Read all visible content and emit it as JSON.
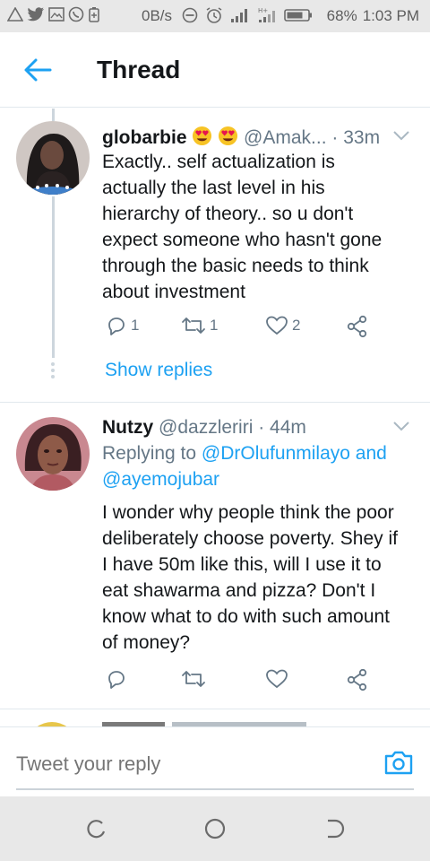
{
  "status_bar": {
    "speed": "0B/s",
    "battery": "68%",
    "time": "1:03 PM"
  },
  "header": {
    "title": "Thread",
    "back_icon": "arrow-left-icon"
  },
  "tweets": [
    {
      "name": "globarbie",
      "emojis": [
        "heart-eyes-emoji",
        "heart-eyes-emoji"
      ],
      "handle": "@Amak...",
      "time": "· 33m",
      "text_lines": [
        "Exactly.. self actualization is",
        "actually the last level in his",
        "hierarchy of theory.. so u don't",
        "expect someone who hasn't gone",
        "through the basic needs to think",
        "about investment"
      ],
      "replies": "1",
      "retweets": "1",
      "likes": "2",
      "show_replies": "Show replies"
    },
    {
      "name": "Nutzy",
      "handle": "@dazzleriri",
      "time": "· 44m",
      "replying_prefix": "Replying to",
      "replying_user1": "@DrOlufunmilayo",
      "replying_and": "and",
      "replying_user2": "@ayemojubar",
      "text_lines": [
        "I wonder why people think the poor",
        "deliberately choose poverty. Shey if",
        "I have 50m like this, will I use it to",
        "eat shawarma and pizza? Don't I",
        "know what  to do with such amount",
        "of money?"
      ]
    }
  ],
  "reply_box": {
    "placeholder": "Tweet your reply"
  },
  "colors": {
    "accent": "#1da1f2",
    "secondary_text": "#657786",
    "divider": "#e1e8ed",
    "system_bar": "#e8e8e8"
  }
}
